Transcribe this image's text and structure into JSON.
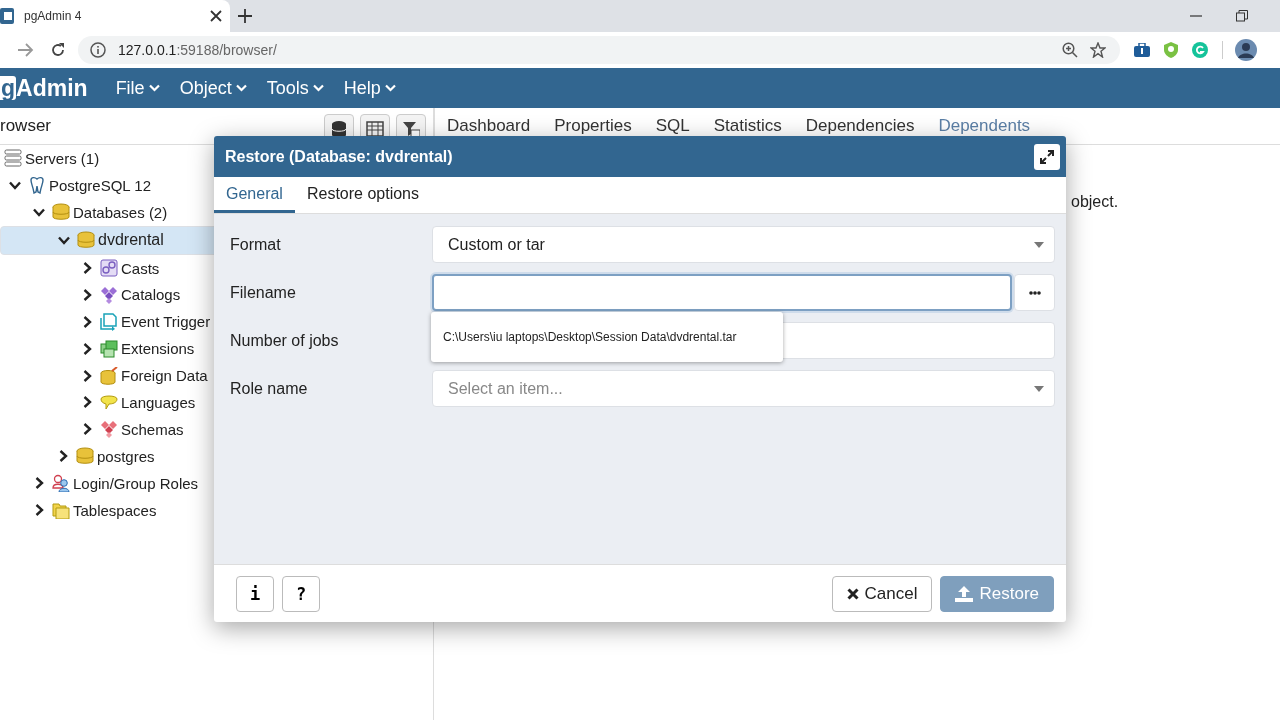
{
  "browser_tab": {
    "title": "pgAdmin 4",
    "selected": true
  },
  "address_bar": {
    "host": "127.0.0.1",
    "path": ":59188/browser/"
  },
  "app_bar": {
    "logo_boxed": "g",
    "logo_text": "Admin",
    "menus": [
      "File",
      "Object",
      "Tools",
      "Help"
    ]
  },
  "browser_panel": {
    "title": "rowser",
    "tree": [
      {
        "label": "Servers (1)",
        "kind": "server-group",
        "selected": false,
        "children": [
          {
            "label": "PostgreSQL 12",
            "kind": "server",
            "expanded": true,
            "selected": false,
            "children": [
              {
                "label": "Databases (2)",
                "kind": "database",
                "expanded": true,
                "selected": false,
                "children": [
                  {
                    "label": "dvdrental",
                    "kind": "database",
                    "expanded": true,
                    "selected": true,
                    "children": [
                      {
                        "label": "Casts",
                        "kind": "cast",
                        "expanded": false,
                        "selected": false
                      },
                      {
                        "label": "Catalogs",
                        "kind": "catalog",
                        "expanded": false,
                        "selected": false
                      },
                      {
                        "label": "Event Trigger",
                        "kind": "trigger",
                        "expanded": false,
                        "selected": false
                      },
                      {
                        "label": "Extensions",
                        "kind": "extension",
                        "expanded": false,
                        "selected": false
                      },
                      {
                        "label": "Foreign Data",
                        "kind": "foreign",
                        "expanded": false,
                        "selected": false
                      },
                      {
                        "label": "Languages",
                        "kind": "language",
                        "expanded": false,
                        "selected": false
                      },
                      {
                        "label": "Schemas",
                        "kind": "schema",
                        "expanded": false,
                        "selected": false
                      }
                    ]
                  },
                  {
                    "label": "postgres",
                    "kind": "database",
                    "expanded": false,
                    "selected": false
                  }
                ]
              },
              {
                "label": "Login/Group Roles",
                "kind": "role",
                "expanded": false,
                "selected": false
              },
              {
                "label": "Tablespaces",
                "kind": "tablespace",
                "expanded": false,
                "selected": false
              }
            ]
          }
        ]
      }
    ]
  },
  "main_tabs": [
    {
      "label": "Dashboard",
      "selected": false
    },
    {
      "label": "Properties",
      "selected": false
    },
    {
      "label": "SQL",
      "selected": false
    },
    {
      "label": "Statistics",
      "selected": false
    },
    {
      "label": "Dependencies",
      "selected": false
    },
    {
      "label": "Dependents",
      "selected": true
    }
  ],
  "background_text": "object.",
  "dialog": {
    "title": "Restore (Database: dvdrental)",
    "tabs": [
      {
        "label": "General",
        "selected": true
      },
      {
        "label": "Restore options",
        "selected": false
      }
    ],
    "fields": [
      {
        "label": "Format",
        "kind": "select",
        "value": "Custom or tar",
        "focused": false
      },
      {
        "label": "Filename",
        "kind": "file",
        "focused": true
      },
      {
        "label": "Number of jobs",
        "kind": "text",
        "focused": false
      },
      {
        "label": "Role name",
        "kind": "select",
        "placeholder": "Select an item...",
        "focused": false
      }
    ],
    "suggestion": "C:\\Users\\iu laptops\\Desktop\\Session Data\\dvdrental.tar",
    "footer_left": [
      "i",
      "?"
    ],
    "buttons": [
      {
        "label": "Cancel",
        "kind": "cancel",
        "disabled": false
      },
      {
        "label": "Restore",
        "kind": "restore",
        "disabled": true
      }
    ]
  }
}
